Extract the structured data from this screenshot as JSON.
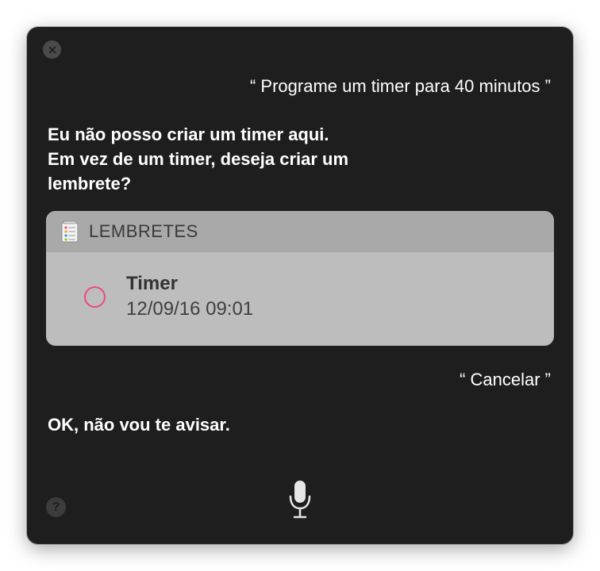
{
  "window": {
    "close_icon": "close-icon",
    "help_label": "?",
    "mic_icon": "microphone-icon"
  },
  "conversation": {
    "user_request": "“ Programe um timer para 40 minutos ”",
    "assistant_reply_lines": [
      "Eu não posso criar um timer aqui.",
      "Em vez de um timer, deseja criar um",
      "lembrete?"
    ],
    "user_cancel": "“ Cancelar ”",
    "assistant_final": "OK, não vou te avisar."
  },
  "reminder_card": {
    "app_icon": "reminders-app-icon",
    "header": "LEMBRETES",
    "items": [
      {
        "title": "Timer",
        "datetime": "12/09/16 09:01",
        "checked": false
      }
    ]
  },
  "colors": {
    "panel_background": "#1e1e1e",
    "card_background": "#bdbdbd",
    "card_header_background": "#a9a9a9",
    "checkbox_accent": "#ec4a7a"
  }
}
